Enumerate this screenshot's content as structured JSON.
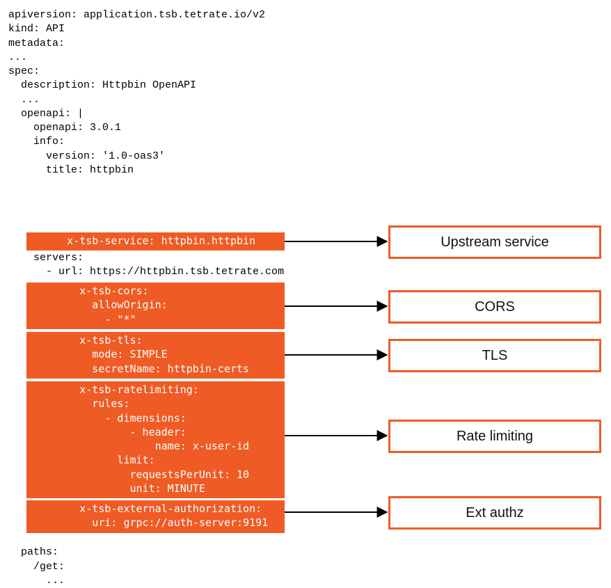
{
  "code": {
    "head": "apiversion: application.tsb.tetrate.io/v2\nkind: API\nmetadata:\n...\nspec:\n  description: Httpbin OpenAPI\n  ...\n  openapi: |\n    openapi: 3.0.1\n    info:\n      version: '1.0-oas3'\n      title: httpbin",
    "service_block": "      x-tsb-service: httpbin.httpbin",
    "servers": "    servers:\n      - url: https://httpbin.tsb.tetrate.com",
    "cors_block": "        x-tsb-cors:\n          allowOrigin:\n            - \"*\"",
    "tls_block": "        x-tsb-tls:\n          mode: SIMPLE\n          secretName: httpbin-certs",
    "ratelimit_block": "        x-tsb-ratelimiting:\n          rules:\n            - dimensions:\n                - header:\n                    name: x-user-id\n              limit:\n                requestsPerUnit: 10\n                unit: MINUTE",
    "extauth_block": "        x-tsb-external-authorization:\n          uri: grpc://auth-server:9191",
    "tail": "\n  paths:\n    /get:\n      ..."
  },
  "labels": {
    "upstream": "Upstream service",
    "cors": "CORS",
    "tls": "TLS",
    "ratelimit": "Rate limiting",
    "extauth": "Ext authz"
  }
}
